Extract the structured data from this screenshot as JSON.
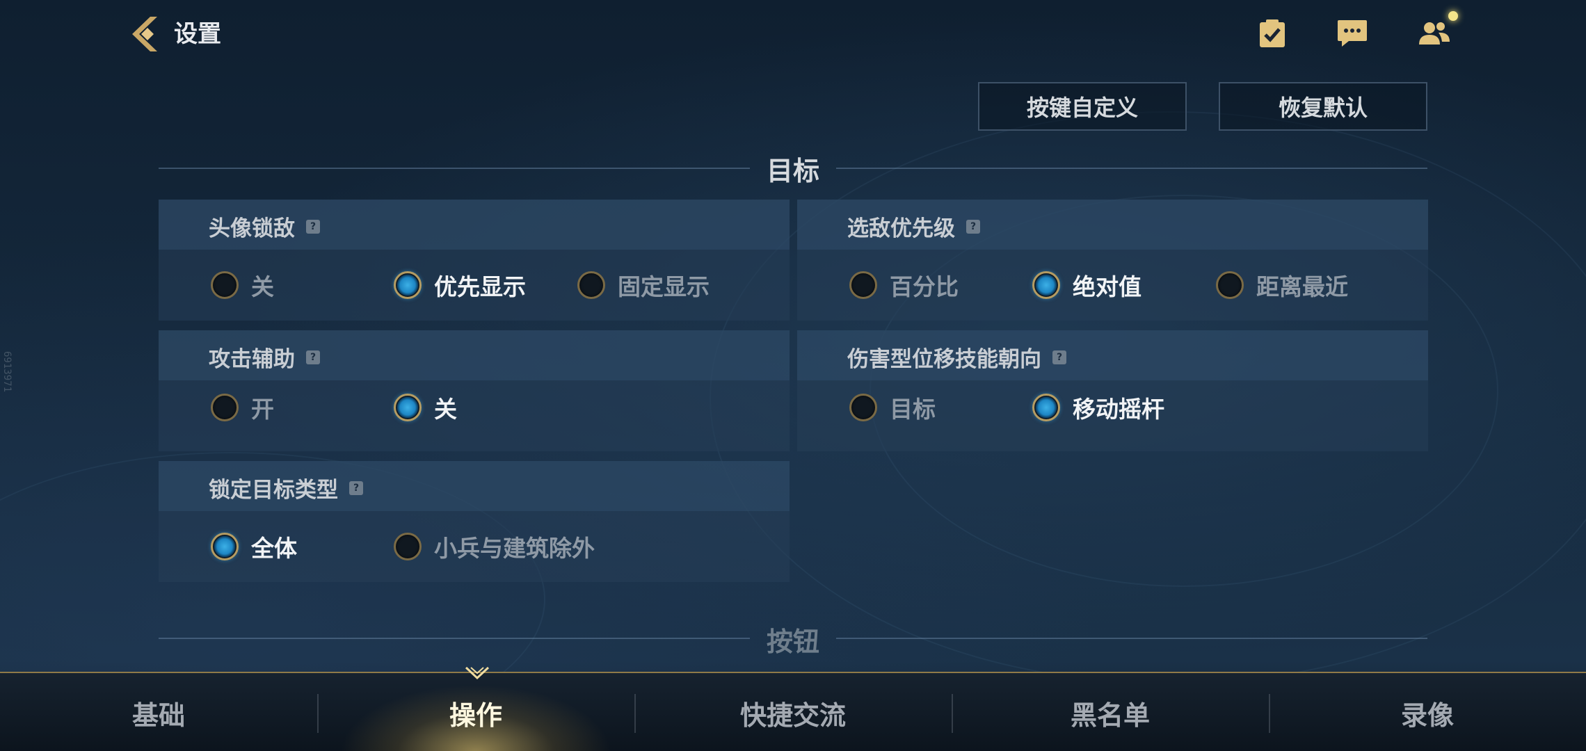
{
  "header": {
    "title": "设置"
  },
  "actions": {
    "custom_keys": "按键自定义",
    "restore_default": "恢复默认"
  },
  "side_code": "6913971",
  "sections": {
    "target": "目标",
    "buttons": "按钮"
  },
  "panels": {
    "avatar_lock": {
      "title": "头像锁敌",
      "options": [
        "关",
        "优先显示",
        "固定显示"
      ],
      "selected": "优先显示"
    },
    "enemy_priority": {
      "title": "选敌优先级",
      "options": [
        "百分比",
        "绝对值",
        "距离最近"
      ],
      "selected": "绝对值"
    },
    "attack_assist": {
      "title": "攻击辅助",
      "options": [
        "开",
        "关"
      ],
      "selected": "关"
    },
    "dash_direction": {
      "title": "伤害型位移技能朝向",
      "options": [
        "目标",
        "移动摇杆"
      ],
      "selected": "移动摇杆"
    },
    "lock_target_type": {
      "title": "锁定目标类型",
      "options": [
        "全体",
        "小兵与建筑除外"
      ],
      "selected": "全体"
    }
  },
  "nav": {
    "items": [
      "基础",
      "操作",
      "快捷交流",
      "黑名单",
      "录像"
    ],
    "active": "操作"
  },
  "colors": {
    "accent_gold": "#b49c63",
    "radio_on_blue": "#3cb0e6",
    "notify_dot": "#f5e58a"
  }
}
